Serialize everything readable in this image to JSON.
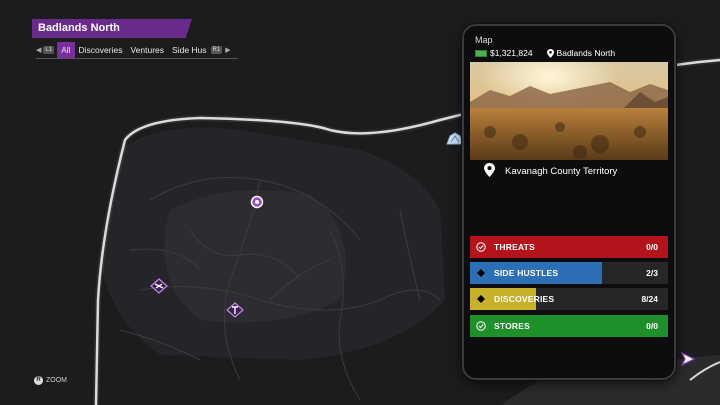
{
  "header": {
    "region": "Badlands North",
    "filter_tabs": [
      "All",
      "Discoveries",
      "Ventures",
      "Side Hus"
    ],
    "left_button": "L1",
    "right_button": "R1"
  },
  "zoom_hint": {
    "button": "R",
    "label": "ZOOM"
  },
  "phone": {
    "title": "Map",
    "money": "$1,321,824",
    "location": "Badlands North",
    "territory": "Kavanagh County Territory",
    "categories": [
      {
        "label": "THREATS",
        "count": "0/0",
        "color": "#b3131b",
        "progress": 1.0
      },
      {
        "label": "SIDE HUSTLES",
        "count": "2/3",
        "color": "#2d6fb5",
        "progress": 0.667
      },
      {
        "label": "DISCOVERIES",
        "count": "8/24",
        "color": "#c7b02a",
        "progress": 0.333
      },
      {
        "label": "STORES",
        "count": "0/0",
        "color": "#1f8f2a",
        "progress": 1.0
      }
    ]
  },
  "colors": {
    "accent": "#7a2e9e",
    "road": "#d8d8dc"
  }
}
